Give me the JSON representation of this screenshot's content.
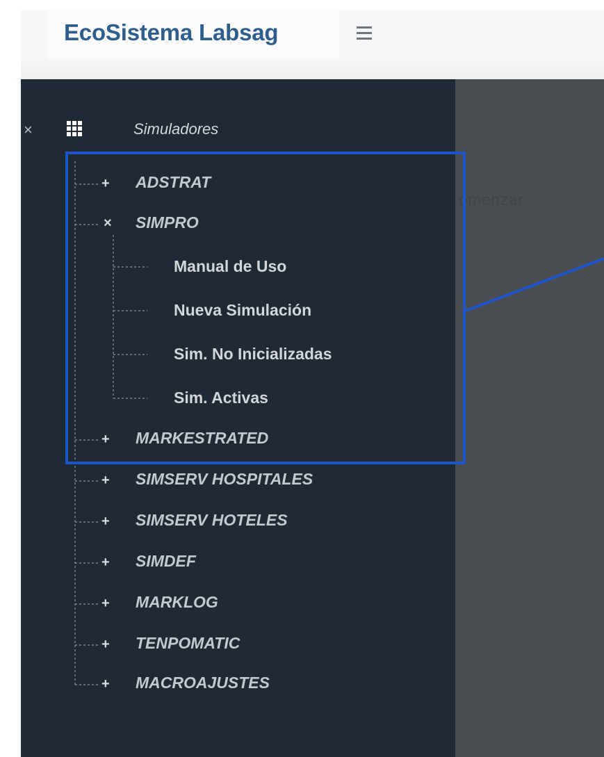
{
  "header": {
    "brand": "EcoSistema Labsag",
    "menu_icon": "hamburger-menu-icon"
  },
  "main": {
    "partial_text": "omenzar"
  },
  "sidebar": {
    "close_icon": "close-icon",
    "root": {
      "icon": "grid-icon",
      "label": "Simuladores"
    },
    "items": [
      {
        "label": "ADSTRAT",
        "toggle": "+"
      },
      {
        "label": "SIMPRO",
        "toggle": "×",
        "children": [
          {
            "label": "Manual de Uso"
          },
          {
            "label": "Nueva Simulación"
          },
          {
            "label": "Sim. No Inicializadas"
          },
          {
            "label": "Sim. Activas"
          }
        ]
      },
      {
        "label": "MARKESTRATED",
        "toggle": "+"
      },
      {
        "label": "SIMSERV HOSPITALES",
        "toggle": "+"
      },
      {
        "label": "SIMSERV HOTELES",
        "toggle": "+"
      },
      {
        "label": "SIMDEF",
        "toggle": "+"
      },
      {
        "label": "MARKLOG",
        "toggle": "+"
      },
      {
        "label": "TENPOMATIC",
        "toggle": "+"
      },
      {
        "label": "MACROAJUSTES",
        "toggle": "+"
      }
    ]
  },
  "annotation": {
    "highlight_color": "#1e56c8"
  },
  "colors": {
    "sidebar_bg": "#1f2a35",
    "brand": "#2d5e8c",
    "overlay": "#4a4d4f"
  }
}
